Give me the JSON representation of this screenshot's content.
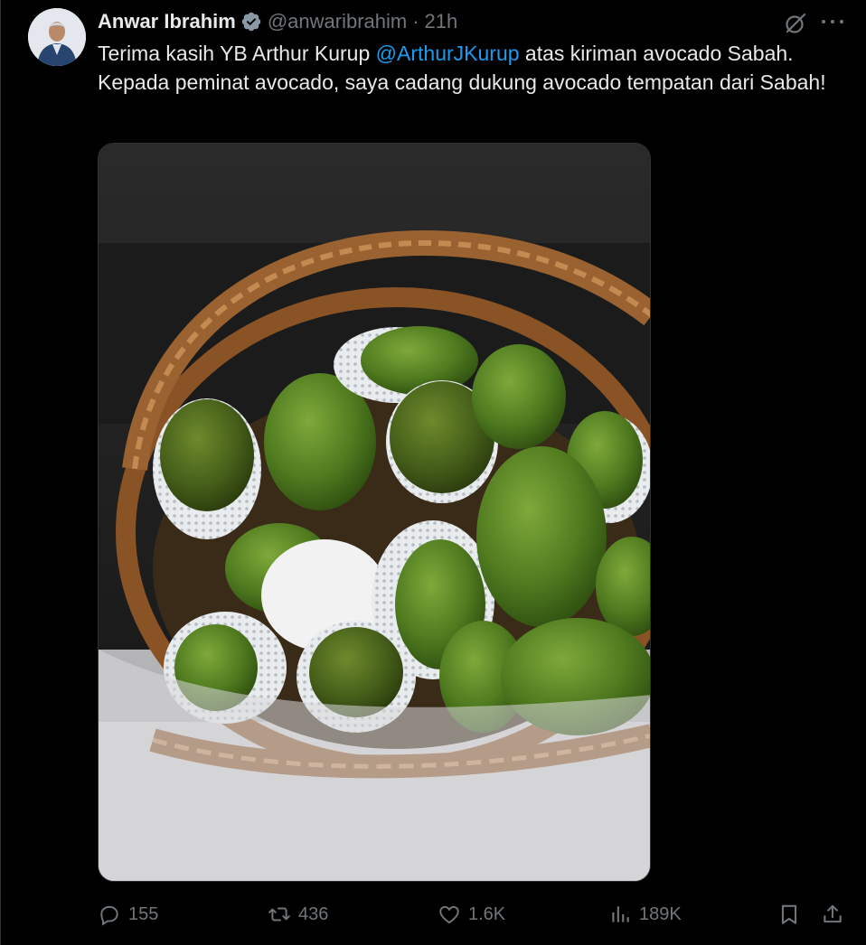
{
  "author": {
    "name": "Anwar Ibrahim",
    "handle": "@anwaribrahim",
    "separator": "·",
    "time": "21h"
  },
  "tweet": {
    "text_part1": "Terima kasih YB Arthur Kurup ",
    "mention": "@ArthurJKurup",
    "text_part2": " atas kiriman avocado Sabah. Kepada peminat avocado, saya cadang dukung avocado tempatan dari Sabah!"
  },
  "metrics": {
    "replies": "155",
    "reposts": "436",
    "likes": "1.6K",
    "views": "189K"
  },
  "icons": {
    "verified": "verified-badge-icon",
    "grok": "grok-icon",
    "more": "more-icon",
    "reply": "reply-icon",
    "repost": "repost-icon",
    "like": "heart-icon",
    "views": "views-icon",
    "bookmark": "bookmark-icon",
    "share": "share-icon"
  },
  "colors": {
    "background": "#000000",
    "text": "#e7e9ea",
    "muted": "#71767b",
    "accent": "#1d9bf0"
  }
}
